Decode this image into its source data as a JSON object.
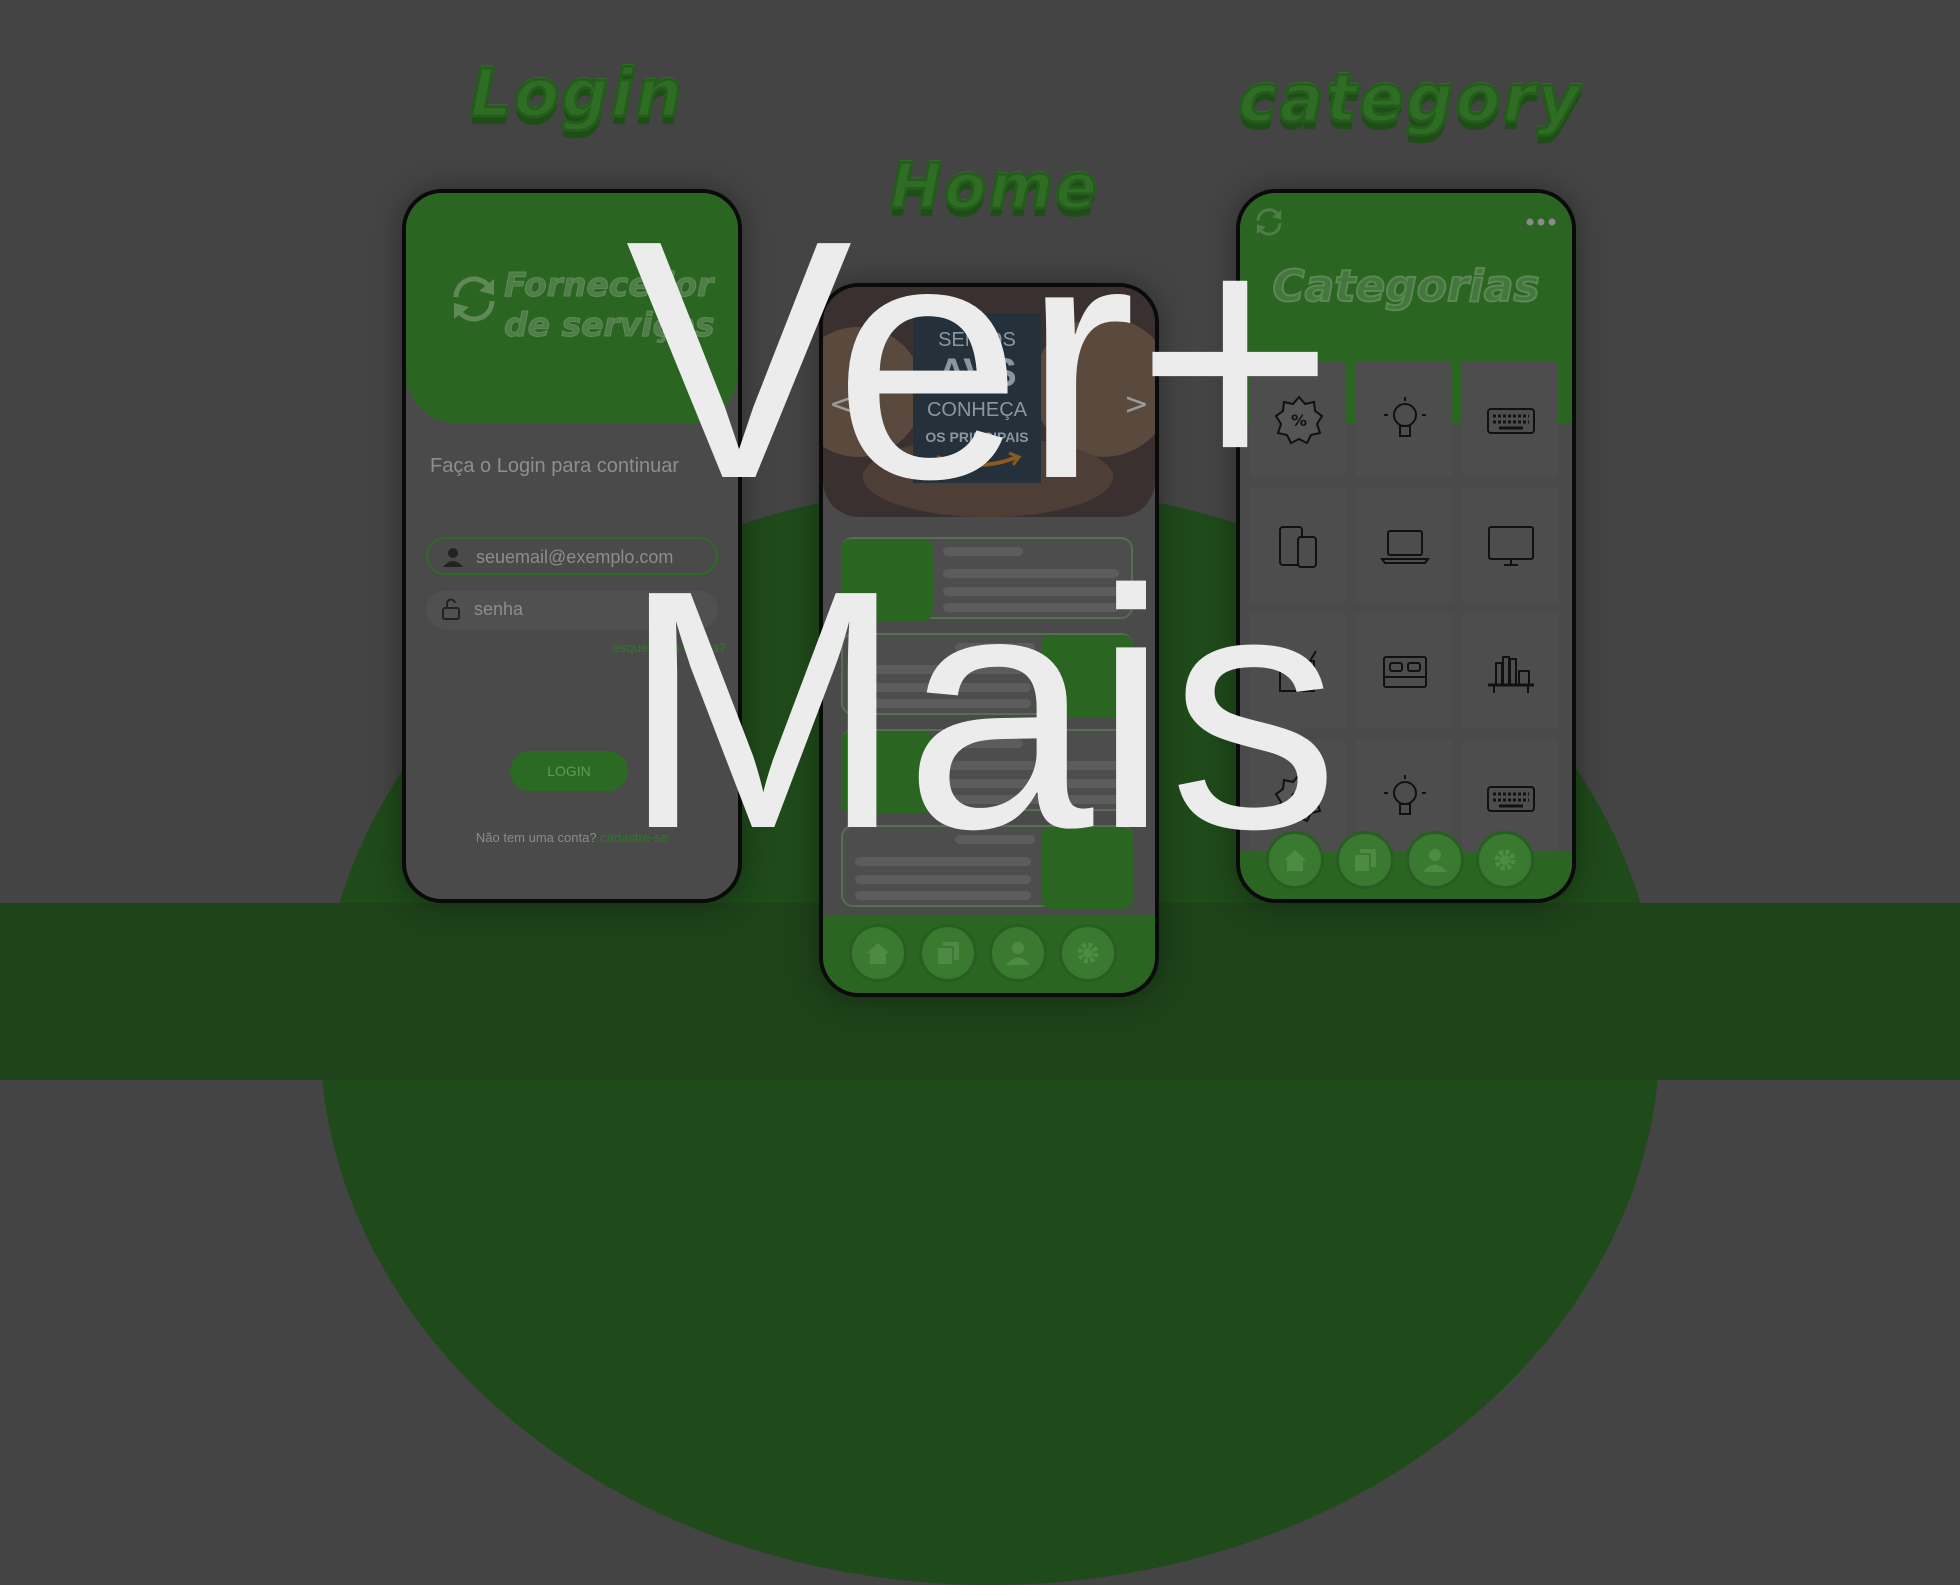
{
  "titles": {
    "login": "Login",
    "home": "Home",
    "category": "category"
  },
  "login": {
    "brand_line1": "Fornecedor",
    "brand_line2": "de serviços",
    "prompt": "Faça o Login para continuar",
    "email_placeholder": "seuemail@exemplo.com",
    "password_placeholder": "senha",
    "forgot": "esqueceu a senha?",
    "button": "LOGIN",
    "signup_question": "Não tem uma conta?",
    "signup_link": "cadastre-se"
  },
  "home": {
    "banner_line1": "SEM OS",
    "banner_line2": "AVS",
    "banner_line3": "CONHEÇA",
    "banner_line4": "OS PRINCIPAIS"
  },
  "category": {
    "title": "Categorias",
    "icons": [
      "discount-icon",
      "lightbulb-icon",
      "keyboard-icon",
      "phone-tablet-icon",
      "laptop-icon",
      "monitor-icon",
      "appliance-icon",
      "bed-icon",
      "bookshelf-icon",
      "discount-icon",
      "lightbulb-icon",
      "keyboard-icon"
    ]
  },
  "nav_icons": [
    "home-icon",
    "pages-icon",
    "user-icon",
    "gear-icon"
  ],
  "overlay": {
    "line1": "Ver+",
    "line2": "Mais"
  },
  "colors": {
    "background": "#444444",
    "brand_green": "#2a6522",
    "overlay_text": "#ececec"
  }
}
